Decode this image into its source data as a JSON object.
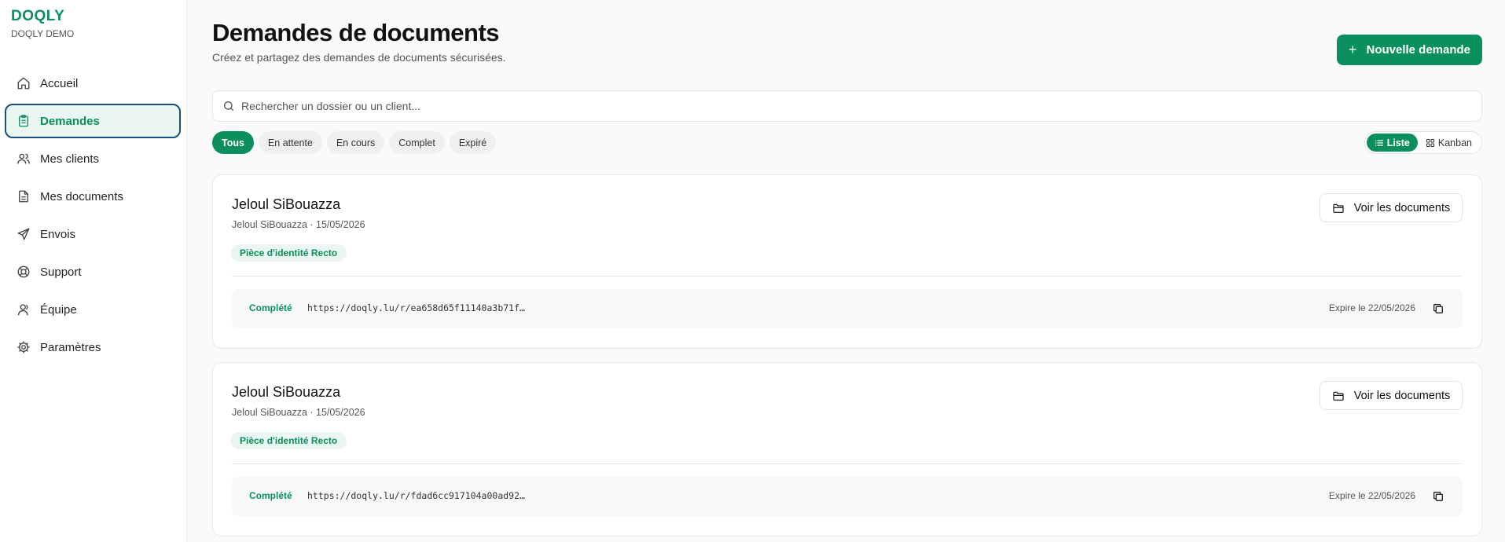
{
  "brand": {
    "logo": "DOQLY",
    "subtitle": "DOQLY DEMO"
  },
  "sidebar": {
    "items": [
      {
        "label": "Accueil",
        "icon": "home-icon"
      },
      {
        "label": "Demandes",
        "icon": "clipboard-icon",
        "active": true
      },
      {
        "label": "Mes clients",
        "icon": "users-icon"
      },
      {
        "label": "Mes documents",
        "icon": "file-icon"
      },
      {
        "label": "Envois",
        "icon": "send-icon"
      },
      {
        "label": "Support",
        "icon": "lifebuoy-icon"
      },
      {
        "label": "Équipe",
        "icon": "user-icon"
      },
      {
        "label": "Paramètres",
        "icon": "gear-icon"
      }
    ]
  },
  "header": {
    "title": "Demandes de documents",
    "subtitle": "Créez et partagez des demandes de documents sécurisées.",
    "new_button": "Nouvelle demande"
  },
  "search": {
    "placeholder": "Rechercher un dossier ou un client..."
  },
  "filters": [
    "Tous",
    "En attente",
    "En cours",
    "Complet",
    "Expiré"
  ],
  "active_filter": "Tous",
  "view": {
    "list_label": "Liste",
    "kanban_label": "Kanban",
    "active": "Liste"
  },
  "requests": [
    {
      "name": "Jeloul SiBouazza",
      "meta": "Jeloul SiBouazza · 15/05/2026",
      "tag": "Pièce d'identité Recto",
      "view_button": "Voir les documents",
      "status": "Complété",
      "url": "https://doqly.lu/r/ea658d65f11140a3b71f…",
      "expiry": "Expire le 22/05/2026"
    },
    {
      "name": "Jeloul SiBouazza",
      "meta": "Jeloul SiBouazza · 15/05/2026",
      "tag": "Pièce d'identité Recto",
      "view_button": "Voir les documents",
      "status": "Complété",
      "url": "https://doqly.lu/r/fdad6cc917104a00ad92…",
      "expiry": "Expire le 22/05/2026"
    }
  ],
  "colors": {
    "accent": "#0b8f5e",
    "accent_light": "#e9f7f0",
    "focus_ring": "#1b4f7a"
  }
}
